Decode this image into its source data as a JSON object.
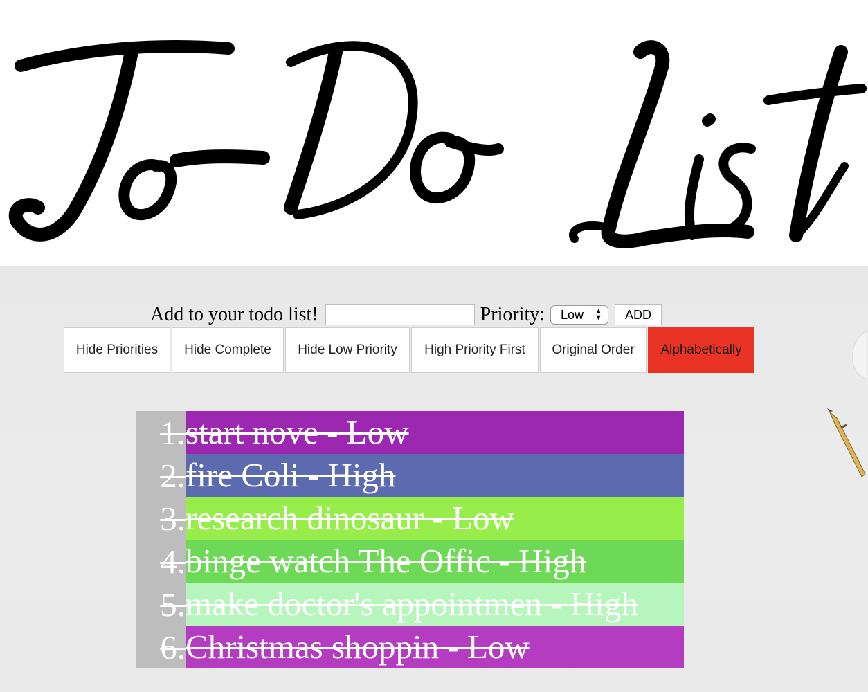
{
  "header": {
    "title": "To-Do List"
  },
  "add_form": {
    "label": "Add to your todo list!",
    "input_value": "",
    "input_placeholder": "",
    "priority_label": "Priority:",
    "priority_selected": "Low",
    "add_button": "ADD"
  },
  "toolbar": {
    "buttons": [
      {
        "label": "Hide Priorities"
      },
      {
        "label": "Hide Complete"
      },
      {
        "label": "Hide Low Priority"
      },
      {
        "label": "High Priority First"
      },
      {
        "label": "Original Order"
      },
      {
        "label": "Alphabetically"
      }
    ],
    "active_button": "Alphabetically",
    "active_color": "#e83325"
  },
  "todos": [
    {
      "number": "1.",
      "text": "start nove - Low",
      "color": "#9c27b0",
      "completed": true
    },
    {
      "number": "2.",
      "text": "fire Coli - High",
      "color": "#5c6bb0",
      "completed": true
    },
    {
      "number": "3.",
      "text": "research dinosaur - Low",
      "color": "#97ee4a",
      "completed": true
    },
    {
      "number": "4.",
      "text": "binge watch The Offic - High",
      "color": "#6ed957",
      "completed": true
    },
    {
      "number": "5.",
      "text": "make doctor's appointmen - High",
      "color": "#b6f5bb",
      "completed": true
    },
    {
      "number": "6.",
      "text": "Christmas shoppin - Low",
      "color": "#b43cc1",
      "completed": true
    }
  ],
  "colors": {
    "list_number_bg": "#bdbdbd",
    "page_bg": "#ebebeb"
  }
}
